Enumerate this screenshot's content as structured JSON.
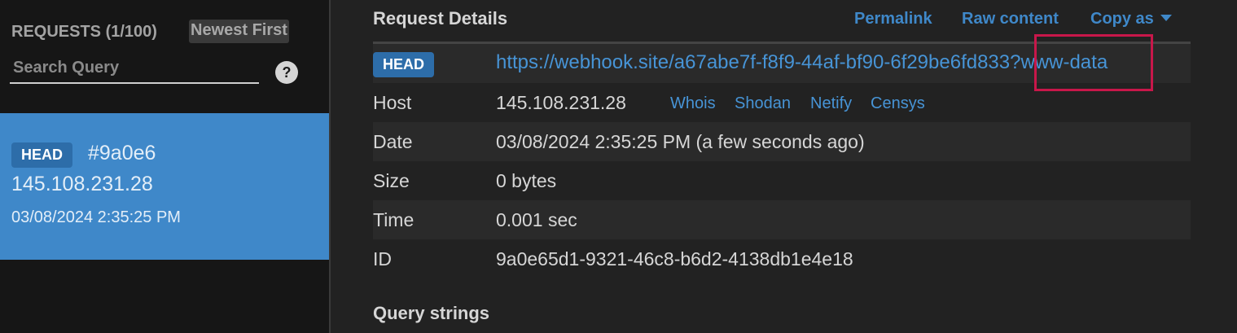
{
  "sidebar": {
    "requests_header": "REQUESTS (1/100)",
    "sort_label": "Newest First",
    "search": {
      "placeholder": "Search Query",
      "value": ""
    },
    "help_label": "?",
    "items": [
      {
        "method": "HEAD",
        "id_short": "#9a0e6",
        "ip": "145.108.231.28",
        "date": "03/08/2024 2:35:25 PM",
        "selected": true
      }
    ]
  },
  "details": {
    "title": "Request Details",
    "actions": {
      "permalink": "Permalink",
      "raw_content": "Raw content",
      "copy_as": "Copy as"
    },
    "method": "HEAD",
    "url": "https://webhook.site/a67abe7f-f8f9-44af-bf90-6f29be6fd833?www-data",
    "host_label": "Host",
    "host_value": "145.108.231.28",
    "ip_links": {
      "whois": "Whois",
      "shodan": "Shodan",
      "netify": "Netify",
      "censys": "Censys"
    },
    "date_label": "Date",
    "date_value": "03/08/2024 2:35:25 PM (a few seconds ago)",
    "size_label": "Size",
    "size_value": "0 bytes",
    "time_label": "Time",
    "time_value": "0.001 sec",
    "id_label": "ID",
    "id_value": "9a0e65d1-9321-46c8-b6d2-4138db1e4e18",
    "query_strings_title": "Query strings"
  },
  "colors": {
    "accent": "#3f88c9",
    "link": "#4794d6",
    "highlight": "#c8174a",
    "background": "#222222",
    "sidebar_background": "#161616"
  }
}
